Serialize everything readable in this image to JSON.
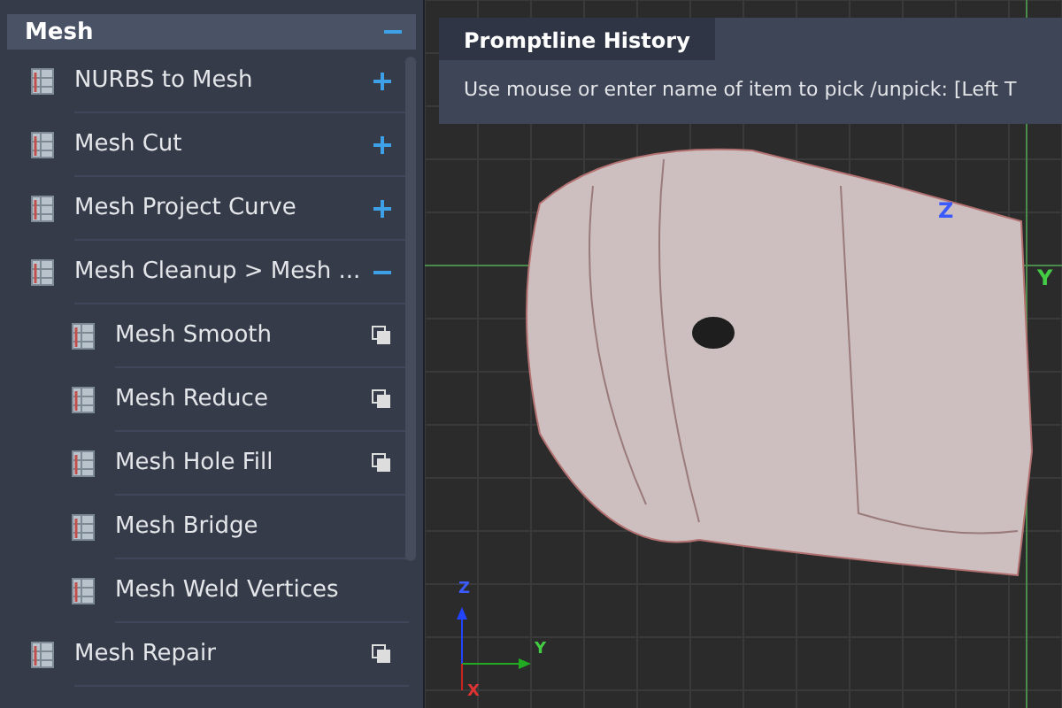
{
  "sidebar": {
    "header": {
      "title": "Mesh",
      "expanded": true
    },
    "items": [
      {
        "label": "NURBS to Mesh",
        "kind": "group",
        "expanded": false
      },
      {
        "label": "Mesh Cut",
        "kind": "group",
        "expanded": false
      },
      {
        "label": "Mesh Project Curve",
        "kind": "group",
        "expanded": false
      },
      {
        "label": "Mesh Cleanup > Mesh ...",
        "kind": "group",
        "expanded": true,
        "children": [
          {
            "label": "Mesh Smooth",
            "kind": "tool",
            "stacked": true
          },
          {
            "label": "Mesh Reduce",
            "kind": "tool",
            "stacked": true
          },
          {
            "label": "Mesh Hole Fill",
            "kind": "tool",
            "stacked": true
          },
          {
            "label": "Mesh Bridge",
            "kind": "tool",
            "stacked": false
          },
          {
            "label": "Mesh Weld Vertices",
            "kind": "tool",
            "stacked": false
          }
        ]
      },
      {
        "label": "Mesh Repair",
        "kind": "tool",
        "stacked": true
      }
    ]
  },
  "promptline": {
    "title": "Promptline History",
    "text": "Use mouse or enter name of item to pick /unpick: [Left T"
  },
  "viewport": {
    "axis_labels": {
      "z": "Z",
      "y": "Y"
    },
    "triad_labels": {
      "z": "Z",
      "y": "Y",
      "x": "X"
    }
  }
}
